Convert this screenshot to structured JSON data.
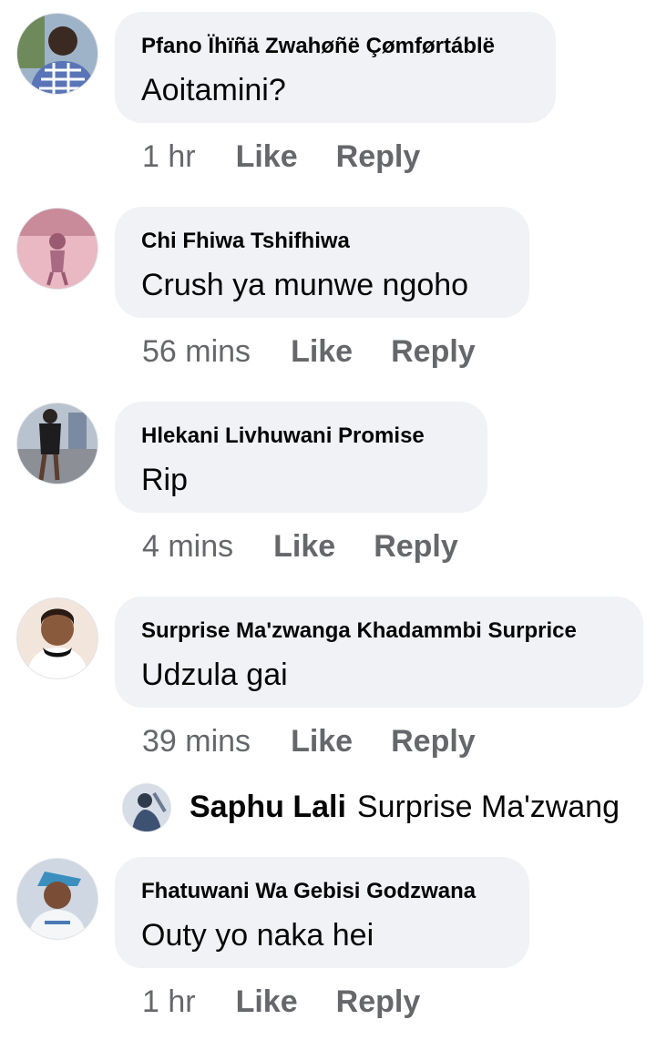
{
  "comments": [
    {
      "author": "Pfano Ïhïñä Zwahøñë Çømførtáblë",
      "text": "Aoitamini?",
      "time": "1 hr",
      "like_label": "Like",
      "reply_label": "Reply",
      "avatar": "man-in-plaid-shirt-avatar"
    },
    {
      "author": "Chi Fhiwa Tshifhiwa",
      "text": "Crush ya munwe ngoho",
      "time": "56 mins",
      "like_label": "Like",
      "reply_label": "Reply",
      "avatar": "pink-tinted-figure-avatar"
    },
    {
      "author": "Hlekani  Livhuwani Promise",
      "text": "Rip",
      "time": "4 mins",
      "like_label": "Like",
      "reply_label": "Reply",
      "avatar": "woman-standing-outdoors-avatar"
    },
    {
      "author": "Surprise Ma'zwanga Khadammbi Surprice",
      "text": "Udzula gai",
      "time": "39 mins",
      "like_label": "Like",
      "reply_label": "Reply",
      "avatar": "woman-portrait-avatar"
    },
    {
      "author": "Fhatuwani Wa Gebisi Godzwana",
      "text": "Outy yo naka hei",
      "time": "1 hr",
      "like_label": "Like",
      "reply_label": "Reply",
      "avatar": "man-in-cap-avatar"
    }
  ],
  "reply_preview": {
    "author": "Saphu Lali",
    "text": "Surprise Ma'zwang",
    "avatar": "reply-user-avatar"
  },
  "colors": {
    "bubble": "#f0f2f5",
    "text": "#050505",
    "meta": "#65676b"
  }
}
